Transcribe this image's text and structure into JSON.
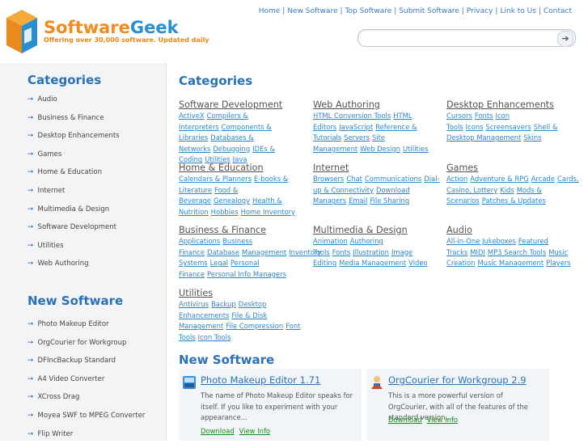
{
  "brand": {
    "part1": "Software",
    "part2": "Geek",
    "tagline": "Offering over 30,000 software. Updated daily"
  },
  "topnav": [
    "Home",
    "New Software",
    "Top Software",
    "Submit Software",
    "Privacy",
    "Link to Us",
    "Contact"
  ],
  "search": {
    "placeholder": "",
    "go_icon": "arrow-right-icon"
  },
  "sidebar": {
    "categories_title": "Categories",
    "categories": [
      "Audio",
      "Business & Finance",
      "Desktop Enhancements",
      "Games",
      "Home & Education",
      "Internet",
      "Multimedia & Design",
      "Software Development",
      "Utilities",
      "Web Authoring"
    ],
    "new_software_title": "New Software",
    "new_software": [
      "Photo Makeup Editor",
      "OrgCourier for Workgroup",
      "DFIncBackup Standard",
      "A4 Video Converter",
      "XCross Drag",
      "Moyea SWF to MPEG Converter",
      "Flip Writer"
    ]
  },
  "main": {
    "categories_title": "Categories",
    "categories": [
      {
        "title": "Software Development",
        "links": [
          "ActiveX",
          "Compilers & Interpreters",
          "Components & Libraries",
          "Databases & Networks",
          "Debugging",
          "IDEs & Coding",
          "Utilities",
          "Java"
        ]
      },
      {
        "title": "Web Authoring",
        "links": [
          "HTML Conversion Tools",
          "HTML Editors",
          "JavaScript",
          "Reference & Tutorials",
          "Servers",
          "Site Management",
          "Web Design",
          "Utilities"
        ]
      },
      {
        "title": "Desktop Enhancements",
        "links": [
          "Cursors",
          "Fonts",
          "Icon Tools",
          "Icons",
          "Screensavers",
          "Shell & Desktop Management",
          "Skins"
        ]
      },
      {
        "title": "Home & Education",
        "links": [
          "Calendars & Planners",
          "E-books & Literature",
          "Food & Beverage",
          "Genealogy",
          "Health & Nutrition",
          "Hobbies",
          "Home Inventory"
        ]
      },
      {
        "title": "Internet",
        "links": [
          "Browsers",
          "Chat",
          "Communications",
          "Dial-up & Connectivity",
          "Download Managers",
          "Email",
          "File Sharing"
        ]
      },
      {
        "title": "Games",
        "links": [
          "Action",
          "Adventure & RPG",
          "Arcade",
          "Cards, Casino, Lottery",
          "Kids",
          "Mods & Scenarios",
          "Patches & Updates"
        ]
      },
      {
        "title": "Business & Finance",
        "links": [
          "Applications",
          "Business Finance",
          "Database",
          "Management",
          "Inventory Systems",
          "Legal",
          "Personal Finance",
          "Personal Info Managers"
        ]
      },
      {
        "title": "Multimedia & Design",
        "links": [
          "Animation",
          "Authoring Tools",
          "Fonts",
          "Illustration",
          "Image Editing",
          "Media Management",
          "Video"
        ]
      },
      {
        "title": "Audio",
        "links": [
          "All-in-One Jukeboxes",
          "Featured Tracks",
          "MIDI",
          "MP3 Search Tools",
          "Music Creation",
          "Music Management",
          "Players"
        ]
      },
      {
        "title": "Utilities",
        "links": [
          "Antivirus",
          "Backup",
          "Desktop Enhancements",
          "File & Disk Management",
          "File Compression",
          "Font Tools",
          "Icon Tools"
        ]
      }
    ],
    "new_software_title": "New Software",
    "new_software": [
      {
        "name": "Photo Makeup Editor 1.71",
        "desc": "The name of Photo Makeup Editor speaks for itself. If you like to experiment with your appearance...",
        "download": "Download",
        "view": "View Info",
        "icon": "photo-editor-icon"
      },
      {
        "name": "OrgCourier for Workgroup 2.9",
        "desc": "This is a more powerful version of OrgCourier, with all of the features of the standard version,...",
        "download": "Download",
        "view": "View Info",
        "icon": "courier-person-icon"
      }
    ]
  },
  "colors": {
    "accent_blue": "#2a72b8",
    "brand_orange": "#f28c1e",
    "brand_blue": "#2a8fd1",
    "link_green": "#1a8c1a"
  }
}
